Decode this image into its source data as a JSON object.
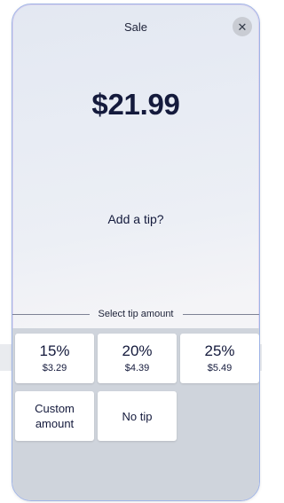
{
  "header": {
    "title": "Sale",
    "close_icon": "close-icon"
  },
  "sale": {
    "amount": "$21.99",
    "prompt": "Add a tip?"
  },
  "tip_section": {
    "label": "Select tip amount",
    "options": [
      {
        "percent": "15%",
        "amount": "$3.29"
      },
      {
        "percent": "20%",
        "amount": "$4.39"
      },
      {
        "percent": "25%",
        "amount": "$5.49"
      }
    ],
    "custom_line1": "Custom",
    "custom_line2": "amount",
    "no_tip": "No tip"
  }
}
